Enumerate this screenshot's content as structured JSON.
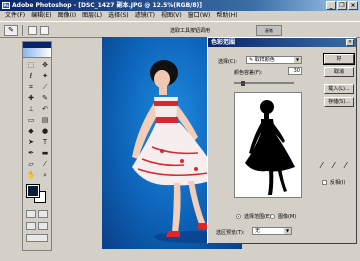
{
  "titlebar": {
    "title": "Adobe Photoshop - [DSC_1427 副本.JPG @ 12.5%(RGB/8)]",
    "app_icon": "Ps"
  },
  "window_controls": {
    "minimize": "_",
    "restore": "❐",
    "close": "×"
  },
  "menu": [
    "文件(F)",
    "编辑(E)",
    "图像(I)",
    "图层(L)",
    "选择(S)",
    "滤镜(T)",
    "视图(V)",
    "窗口(W)",
    "帮助(H)"
  ],
  "options_bar": {
    "hint": "选取工具按钮调用",
    "brushes_label": "画笔"
  },
  "dialog": {
    "title": "色彩范围",
    "close": "×",
    "select_label": "选择(C):",
    "select_value": "取样颜色",
    "fuzziness_label": "颜色容差(F):",
    "fuzziness_value": "30",
    "buttons": {
      "ok": "好",
      "cancel": "取消",
      "load": "载入(L)...",
      "save": "存储(S)..."
    },
    "invert_label": "反相(I)",
    "radio_selection": "选择范围(E)",
    "radio_image": "图像(M)",
    "preview_label": "选区预览(T):",
    "preview_value": "无"
  },
  "colors": {
    "accent": "#0a246a",
    "canvas_blue": "#0d63b8",
    "foreground": "#0a1d38"
  }
}
